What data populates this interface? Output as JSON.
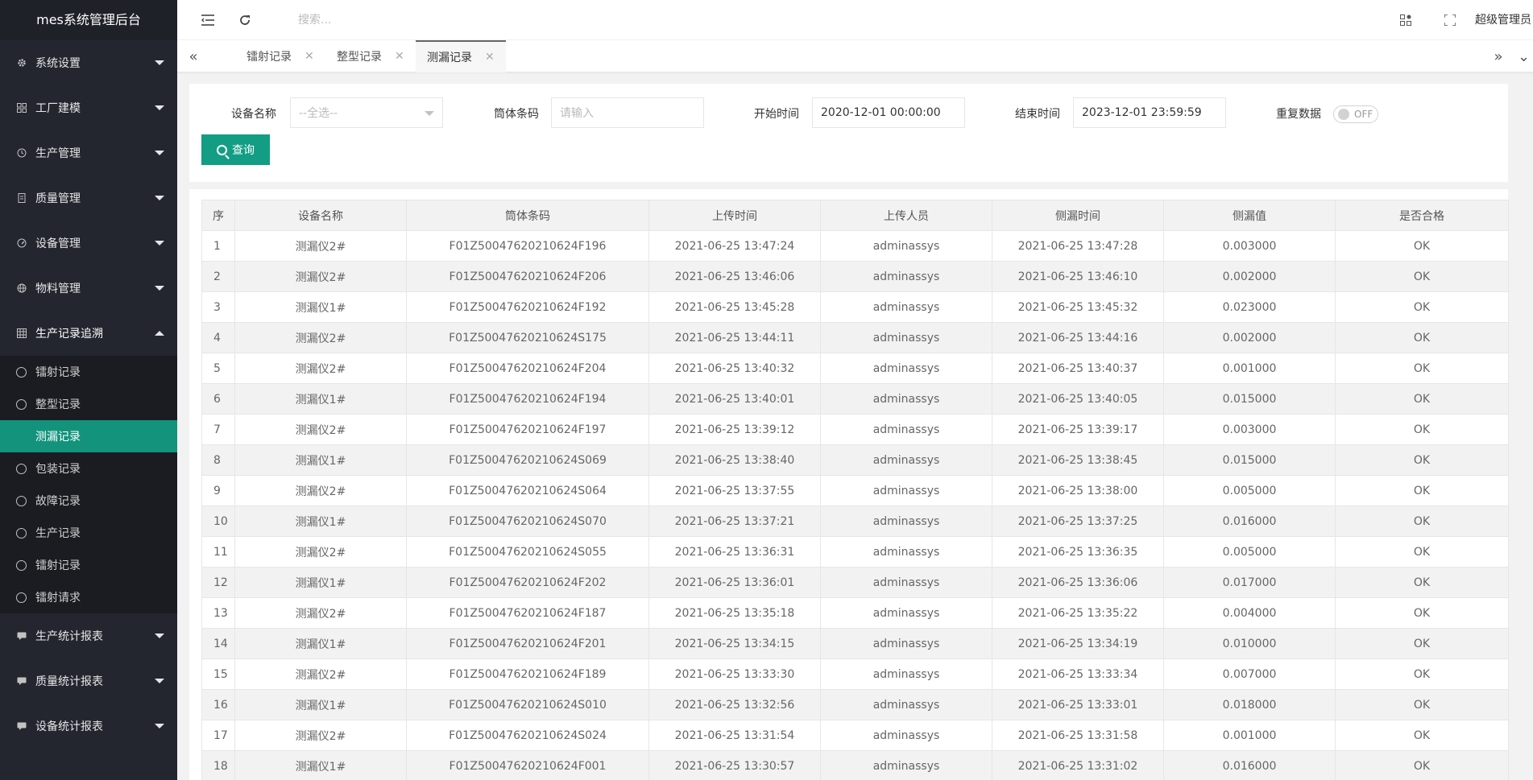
{
  "app": {
    "title": "mes系统管理后台"
  },
  "sidebar": {
    "groups_top": [
      {
        "label": "系统设置",
        "icon": "gear-icon"
      },
      {
        "label": "工厂建模",
        "icon": "grid-icon"
      },
      {
        "label": "生产管理",
        "icon": "clock-icon"
      },
      {
        "label": "质量管理",
        "icon": "document-icon"
      },
      {
        "label": "设备管理",
        "icon": "gauge-icon"
      },
      {
        "label": "物料管理",
        "icon": "globe-icon"
      }
    ],
    "open_group": {
      "label": "生产记录追溯",
      "icon": "table-icon"
    },
    "sub_items": [
      {
        "label": "镭射记录"
      },
      {
        "label": "整型记录"
      },
      {
        "label": "测漏记录"
      },
      {
        "label": "包装记录"
      },
      {
        "label": "故障记录"
      },
      {
        "label": "生产记录"
      },
      {
        "label": "镭射记录"
      },
      {
        "label": "镭射请求"
      }
    ],
    "groups_bottom": [
      {
        "label": "生产统计报表",
        "icon": "chat-icon"
      },
      {
        "label": "质量统计报表",
        "icon": "chat-icon"
      },
      {
        "label": "设备统计报表",
        "icon": "chat-icon"
      }
    ]
  },
  "header": {
    "search_placeholder": "搜索...",
    "user": "超级管理员"
  },
  "tabs": [
    {
      "label": "镭射记录"
    },
    {
      "label": "整型记录"
    },
    {
      "label": "测漏记录"
    }
  ],
  "filters": {
    "device_label": "设备名称",
    "device_placeholder": "--全选--",
    "barcode_label": "筒体条码",
    "barcode_placeholder": "请输入",
    "start_label": "开始时间",
    "start_value": "2020-12-01 00:00:00",
    "end_label": "结束时间",
    "end_value": "2023-12-01 23:59:59",
    "dup_label": "重复数据",
    "dup_state": "OFF",
    "query_label": "查询"
  },
  "table": {
    "headers": [
      "序",
      "设备名称",
      "筒体条码",
      "上传时间",
      "上传人员",
      "侧漏时间",
      "侧漏值",
      "是否合格"
    ],
    "rows": [
      [
        "1",
        "测漏仪2#",
        "F01Z50047620210624F196",
        "2021-06-25 13:47:24",
        "adminassys",
        "2021-06-25 13:47:28",
        "0.003000",
        "OK"
      ],
      [
        "2",
        "测漏仪2#",
        "F01Z50047620210624F206",
        "2021-06-25 13:46:06",
        "adminassys",
        "2021-06-25 13:46:10",
        "0.002000",
        "OK"
      ],
      [
        "3",
        "测漏仪1#",
        "F01Z50047620210624F192",
        "2021-06-25 13:45:28",
        "adminassys",
        "2021-06-25 13:45:32",
        "0.023000",
        "OK"
      ],
      [
        "4",
        "测漏仪2#",
        "F01Z50047620210624S175",
        "2021-06-25 13:44:11",
        "adminassys",
        "2021-06-25 13:44:16",
        "0.002000",
        "OK"
      ],
      [
        "5",
        "测漏仪2#",
        "F01Z50047620210624F204",
        "2021-06-25 13:40:32",
        "adminassys",
        "2021-06-25 13:40:37",
        "0.001000",
        "OK"
      ],
      [
        "6",
        "测漏仪1#",
        "F01Z50047620210624F194",
        "2021-06-25 13:40:01",
        "adminassys",
        "2021-06-25 13:40:05",
        "0.015000",
        "OK"
      ],
      [
        "7",
        "测漏仪2#",
        "F01Z50047620210624F197",
        "2021-06-25 13:39:12",
        "adminassys",
        "2021-06-25 13:39:17",
        "0.003000",
        "OK"
      ],
      [
        "8",
        "测漏仪1#",
        "F01Z50047620210624S069",
        "2021-06-25 13:38:40",
        "adminassys",
        "2021-06-25 13:38:45",
        "0.015000",
        "OK"
      ],
      [
        "9",
        "测漏仪2#",
        "F01Z50047620210624S064",
        "2021-06-25 13:37:55",
        "adminassys",
        "2021-06-25 13:38:00",
        "0.005000",
        "OK"
      ],
      [
        "10",
        "测漏仪1#",
        "F01Z50047620210624S070",
        "2021-06-25 13:37:21",
        "adminassys",
        "2021-06-25 13:37:25",
        "0.016000",
        "OK"
      ],
      [
        "11",
        "测漏仪2#",
        "F01Z50047620210624S055",
        "2021-06-25 13:36:31",
        "adminassys",
        "2021-06-25 13:36:35",
        "0.005000",
        "OK"
      ],
      [
        "12",
        "测漏仪1#",
        "F01Z50047620210624F202",
        "2021-06-25 13:36:01",
        "adminassys",
        "2021-06-25 13:36:06",
        "0.017000",
        "OK"
      ],
      [
        "13",
        "测漏仪2#",
        "F01Z50047620210624F187",
        "2021-06-25 13:35:18",
        "adminassys",
        "2021-06-25 13:35:22",
        "0.004000",
        "OK"
      ],
      [
        "14",
        "测漏仪1#",
        "F01Z50047620210624F201",
        "2021-06-25 13:34:15",
        "adminassys",
        "2021-06-25 13:34:19",
        "0.010000",
        "OK"
      ],
      [
        "15",
        "测漏仪2#",
        "F01Z50047620210624F189",
        "2021-06-25 13:33:30",
        "adminassys",
        "2021-06-25 13:33:34",
        "0.007000",
        "OK"
      ],
      [
        "16",
        "测漏仪1#",
        "F01Z50047620210624S010",
        "2021-06-25 13:32:56",
        "adminassys",
        "2021-06-25 13:33:01",
        "0.018000",
        "OK"
      ],
      [
        "17",
        "测漏仪2#",
        "F01Z50047620210624S024",
        "2021-06-25 13:31:54",
        "adminassys",
        "2021-06-25 13:31:58",
        "0.001000",
        "OK"
      ],
      [
        "18",
        "测漏仪1#",
        "F01Z50047620210624F001",
        "2021-06-25 13:30:57",
        "adminassys",
        "2021-06-25 13:31:02",
        "0.016000",
        "OK"
      ]
    ]
  },
  "colors": {
    "accent": "#129d84",
    "sidebar_bg": "#24262f"
  }
}
